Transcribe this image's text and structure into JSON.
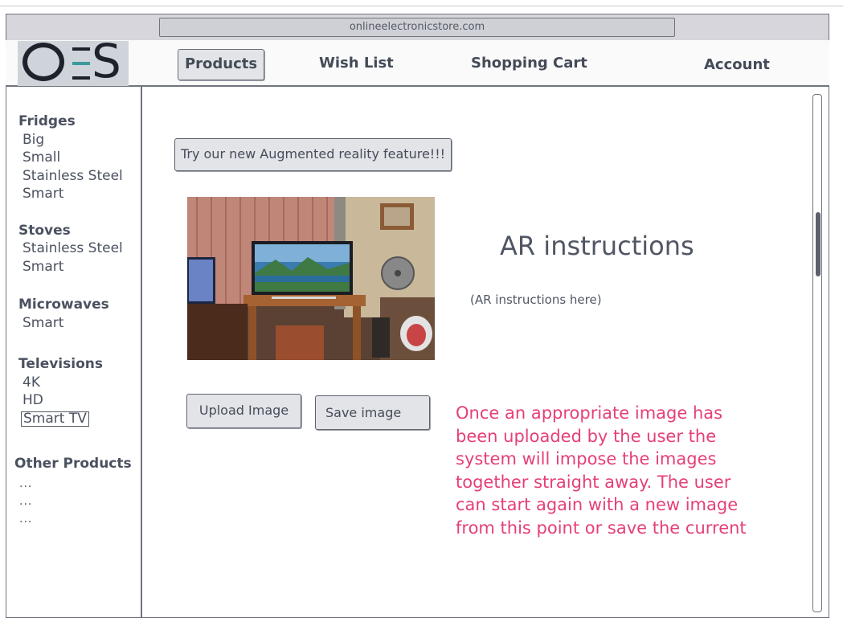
{
  "browser": {
    "url": "onlineelectronicstore.com"
  },
  "logo": {
    "text": "OES"
  },
  "nav": {
    "products": "Products",
    "wish_list": "Wish List",
    "shopping_cart": "Shopping Cart",
    "account": "Account"
  },
  "sidebar": {
    "fridges": {
      "title": "Fridges",
      "items": [
        "Big",
        "Small",
        "Stainless Steel",
        "Smart"
      ]
    },
    "stoves": {
      "title": "Stoves",
      "items": [
        "Stainless Steel",
        "Smart"
      ]
    },
    "microwaves": {
      "title": "Microwaves",
      "items": [
        "Smart"
      ]
    },
    "televisions": {
      "title": "Televisions",
      "items": [
        "4K",
        "HD",
        "Smart TV"
      ]
    },
    "other": {
      "title": "Other Products",
      "items": [
        "...",
        "...",
        "..."
      ]
    }
  },
  "main": {
    "ar_button": "Try our new Augmented reality feature!!!",
    "ar_title": "AR instructions",
    "ar_subtitle": "(AR instructions here)",
    "upload_button": "Upload Image",
    "save_button": "Save image",
    "note": "Once an appropriate image has been uploaded by the user the system will impose the images together straight away. The user can start again with a new image from this point or save the current"
  },
  "colors": {
    "accent_note": "#e63f77",
    "logo_teal": "#3a9a9c"
  }
}
